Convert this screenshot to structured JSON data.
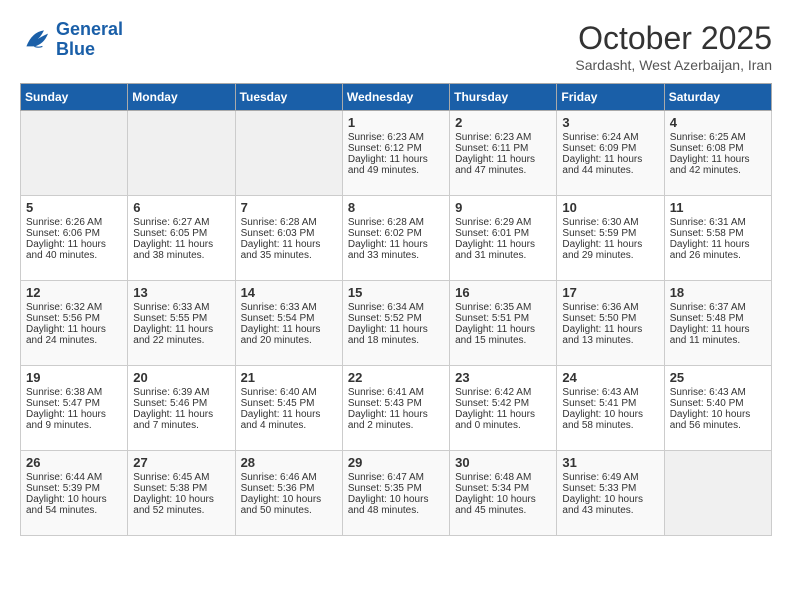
{
  "header": {
    "logo_line1": "General",
    "logo_line2": "Blue",
    "month": "October 2025",
    "location": "Sardasht, West Azerbaijan, Iran"
  },
  "weekdays": [
    "Sunday",
    "Monday",
    "Tuesday",
    "Wednesday",
    "Thursday",
    "Friday",
    "Saturday"
  ],
  "weeks": [
    [
      {
        "day": "",
        "empty": true
      },
      {
        "day": "",
        "empty": true
      },
      {
        "day": "",
        "empty": true
      },
      {
        "day": "1",
        "sunrise": "6:23 AM",
        "sunset": "6:12 PM",
        "daylight": "11 hours and 49 minutes."
      },
      {
        "day": "2",
        "sunrise": "6:23 AM",
        "sunset": "6:11 PM",
        "daylight": "11 hours and 47 minutes."
      },
      {
        "day": "3",
        "sunrise": "6:24 AM",
        "sunset": "6:09 PM",
        "daylight": "11 hours and 44 minutes."
      },
      {
        "day": "4",
        "sunrise": "6:25 AM",
        "sunset": "6:08 PM",
        "daylight": "11 hours and 42 minutes."
      }
    ],
    [
      {
        "day": "5",
        "sunrise": "6:26 AM",
        "sunset": "6:06 PM",
        "daylight": "11 hours and 40 minutes."
      },
      {
        "day": "6",
        "sunrise": "6:27 AM",
        "sunset": "6:05 PM",
        "daylight": "11 hours and 38 minutes."
      },
      {
        "day": "7",
        "sunrise": "6:28 AM",
        "sunset": "6:03 PM",
        "daylight": "11 hours and 35 minutes."
      },
      {
        "day": "8",
        "sunrise": "6:28 AM",
        "sunset": "6:02 PM",
        "daylight": "11 hours and 33 minutes."
      },
      {
        "day": "9",
        "sunrise": "6:29 AM",
        "sunset": "6:01 PM",
        "daylight": "11 hours and 31 minutes."
      },
      {
        "day": "10",
        "sunrise": "6:30 AM",
        "sunset": "5:59 PM",
        "daylight": "11 hours and 29 minutes."
      },
      {
        "day": "11",
        "sunrise": "6:31 AM",
        "sunset": "5:58 PM",
        "daylight": "11 hours and 26 minutes."
      }
    ],
    [
      {
        "day": "12",
        "sunrise": "6:32 AM",
        "sunset": "5:56 PM",
        "daylight": "11 hours and 24 minutes."
      },
      {
        "day": "13",
        "sunrise": "6:33 AM",
        "sunset": "5:55 PM",
        "daylight": "11 hours and 22 minutes."
      },
      {
        "day": "14",
        "sunrise": "6:33 AM",
        "sunset": "5:54 PM",
        "daylight": "11 hours and 20 minutes."
      },
      {
        "day": "15",
        "sunrise": "6:34 AM",
        "sunset": "5:52 PM",
        "daylight": "11 hours and 18 minutes."
      },
      {
        "day": "16",
        "sunrise": "6:35 AM",
        "sunset": "5:51 PM",
        "daylight": "11 hours and 15 minutes."
      },
      {
        "day": "17",
        "sunrise": "6:36 AM",
        "sunset": "5:50 PM",
        "daylight": "11 hours and 13 minutes."
      },
      {
        "day": "18",
        "sunrise": "6:37 AM",
        "sunset": "5:48 PM",
        "daylight": "11 hours and 11 minutes."
      }
    ],
    [
      {
        "day": "19",
        "sunrise": "6:38 AM",
        "sunset": "5:47 PM",
        "daylight": "11 hours and 9 minutes."
      },
      {
        "day": "20",
        "sunrise": "6:39 AM",
        "sunset": "5:46 PM",
        "daylight": "11 hours and 7 minutes."
      },
      {
        "day": "21",
        "sunrise": "6:40 AM",
        "sunset": "5:45 PM",
        "daylight": "11 hours and 4 minutes."
      },
      {
        "day": "22",
        "sunrise": "6:41 AM",
        "sunset": "5:43 PM",
        "daylight": "11 hours and 2 minutes."
      },
      {
        "day": "23",
        "sunrise": "6:42 AM",
        "sunset": "5:42 PM",
        "daylight": "11 hours and 0 minutes."
      },
      {
        "day": "24",
        "sunrise": "6:43 AM",
        "sunset": "5:41 PM",
        "daylight": "10 hours and 58 minutes."
      },
      {
        "day": "25",
        "sunrise": "6:43 AM",
        "sunset": "5:40 PM",
        "daylight": "10 hours and 56 minutes."
      }
    ],
    [
      {
        "day": "26",
        "sunrise": "6:44 AM",
        "sunset": "5:39 PM",
        "daylight": "10 hours and 54 minutes."
      },
      {
        "day": "27",
        "sunrise": "6:45 AM",
        "sunset": "5:38 PM",
        "daylight": "10 hours and 52 minutes."
      },
      {
        "day": "28",
        "sunrise": "6:46 AM",
        "sunset": "5:36 PM",
        "daylight": "10 hours and 50 minutes."
      },
      {
        "day": "29",
        "sunrise": "6:47 AM",
        "sunset": "5:35 PM",
        "daylight": "10 hours and 48 minutes."
      },
      {
        "day": "30",
        "sunrise": "6:48 AM",
        "sunset": "5:34 PM",
        "daylight": "10 hours and 45 minutes."
      },
      {
        "day": "31",
        "sunrise": "6:49 AM",
        "sunset": "5:33 PM",
        "daylight": "10 hours and 43 minutes."
      },
      {
        "day": "",
        "empty": true
      }
    ]
  ]
}
